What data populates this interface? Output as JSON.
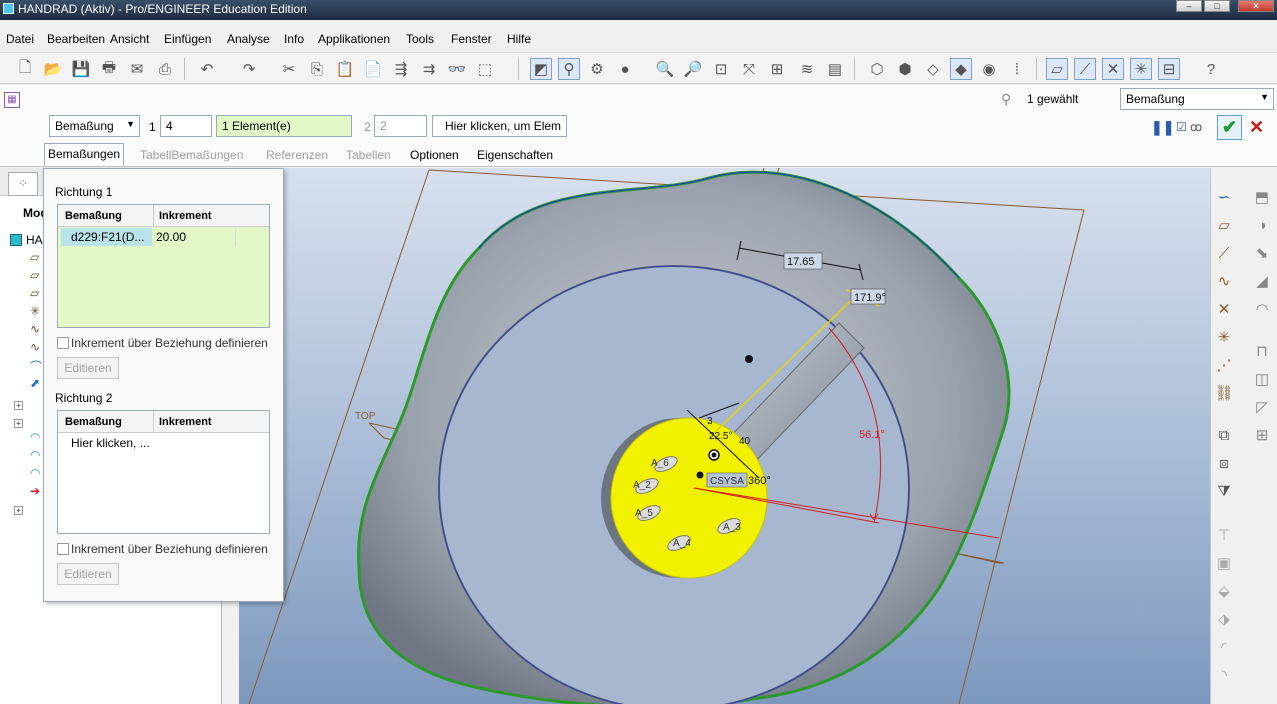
{
  "window": {
    "title": "HANDRAD (Aktiv) - Pro/ENGINEER Education Edition"
  },
  "menu": [
    "Datei",
    "Bearbeiten",
    "Ansicht",
    "Einfügen",
    "Analyse",
    "Info",
    "Applikationen",
    "Tools",
    "Fenster",
    "Hilfe"
  ],
  "dashboard": {
    "type_combo": "Bemaßung",
    "dir1_label": "1",
    "dir1_count": "4",
    "dir1_elements": "1 Element(e)",
    "dir2_label": "2",
    "dir2_count": "2",
    "dir2_prompt": "Hier klicken, um Elem",
    "selection_count": "1 gewählt",
    "filter_combo": "Bemaßung",
    "tabs": [
      "Bemaßungen",
      "TabellBemaßungen",
      "Referenzen",
      "Tabellen",
      "Optionen",
      "Eigenschaften"
    ]
  },
  "panel": {
    "dir1_title": "Richtung 1",
    "col_dimension": "Bemaßung",
    "col_increment": "Inkrement",
    "dir1_rows": [
      {
        "dimension": "d229:F21(D...",
        "increment": "20.00"
      }
    ],
    "relation_checkbox": "Inkrement über Beziehung definieren",
    "edit_button": "Editieren",
    "dir2_title": "Richtung 2",
    "dir2_placeholder": "Hier klicken, ..."
  },
  "model_tree": {
    "header": "Mod",
    "root": "HA"
  },
  "viewport": {
    "dim_linear": "17.65",
    "dim_angle_top": "171.9°",
    "dim_angle_red": "56.1°",
    "datum_top": "TOP",
    "csys_label": "CSYSA",
    "angle_360": "360°",
    "dim_small_a": "22.5°",
    "dim_small_b": "40",
    "dim_small_c": "3",
    "hole_labels": [
      "A_6",
      "A_5",
      "A_4",
      "A_3",
      "A_2"
    ]
  },
  "colors": {
    "viewport_top": "#d7e0ee",
    "viewport_bottom": "#7d98bd",
    "pattern_highlight": "#f2f200",
    "green_field": "#e3f8c7",
    "ok": "#1c9a33",
    "cancel": "#c21a1a"
  }
}
